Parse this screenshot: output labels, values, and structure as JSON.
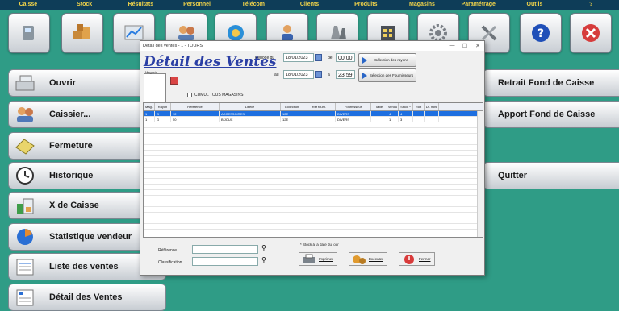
{
  "menubar": {
    "items": [
      "Caisse",
      "Stock",
      "Résultats",
      "Personnel",
      "Télécom",
      "Clients",
      "Produits",
      "Magasins",
      "Paramétrage",
      "Outils",
      "?"
    ]
  },
  "toolbar": {
    "icons": [
      "register-icon",
      "stock-boxes-icon",
      "results-chart-icon",
      "personnel-icon",
      "telecom-icon",
      "clients-icon",
      "products-icon",
      "stores-icon",
      "settings-gear-icon",
      "tools-icon",
      "help-icon",
      "exit-icon"
    ]
  },
  "left_menu": {
    "items": [
      {
        "label": "Ouvrir",
        "icon": "cash-register-icon"
      },
      {
        "label": "Caissier...",
        "icon": "cashier-users-icon"
      },
      {
        "label": "Fermeture",
        "icon": "closing-ticket-icon"
      },
      {
        "label": "Historique",
        "icon": "clock-icon"
      },
      {
        "label": "X de Caisse",
        "icon": "x-report-icon"
      },
      {
        "label": "Statistique vendeur",
        "icon": "pie-chart-icon"
      },
      {
        "label": "Liste des ventes",
        "icon": "sales-list-icon"
      },
      {
        "label": "Détail des Ventes",
        "icon": "sales-detail-icon"
      }
    ]
  },
  "right_menu": {
    "items": [
      {
        "label": "Retrait Fond de Caisse"
      },
      {
        "label": "Apport Fond de Caisse"
      },
      {
        "label": "Quitter"
      }
    ]
  },
  "dialog": {
    "window_title": "Détail des ventes - 1 - TOURS",
    "heading": "Détail des Ventes",
    "photo_label": "Magasin",
    "period_label": "Période du",
    "date_from": "18/01/2023",
    "de_label": "de",
    "time_from": "00:00",
    "au_label": "au",
    "date_to": "18/01/2023",
    "a_label": "à",
    "time_to": "23:59",
    "btn_rayons": "Sélection des rayons",
    "btn_fournisseurs": "Sélection des Fournisseurs",
    "cumul_label": "CUMUL TOUS MAGASINS",
    "columns": [
      "Mag.",
      "Rayon",
      "Référence",
      "Libellé",
      "Collection",
      "Ref fourn.",
      "Fournisseur",
      "Taille",
      "Vendu",
      "Stock *",
      "Rott",
      "Dr. mini"
    ],
    "rows": [
      [
        "1",
        "G",
        "12",
        "ACCESSOIRES",
        "12E",
        "",
        "DIVERS",
        "",
        "4",
        "4",
        "",
        ""
      ],
      [
        "1",
        "G",
        "50",
        "BIJOUX",
        "12E",
        "",
        "DIVERS",
        "",
        "1",
        "3",
        "",
        ""
      ]
    ],
    "reference_label": "Référence",
    "classification_label": "Classification",
    "stock_note": "* Stock à la date du jour",
    "btn_print": "Imprimer",
    "btn_execute": "Exécuter",
    "btn_close": "Fermer"
  }
}
